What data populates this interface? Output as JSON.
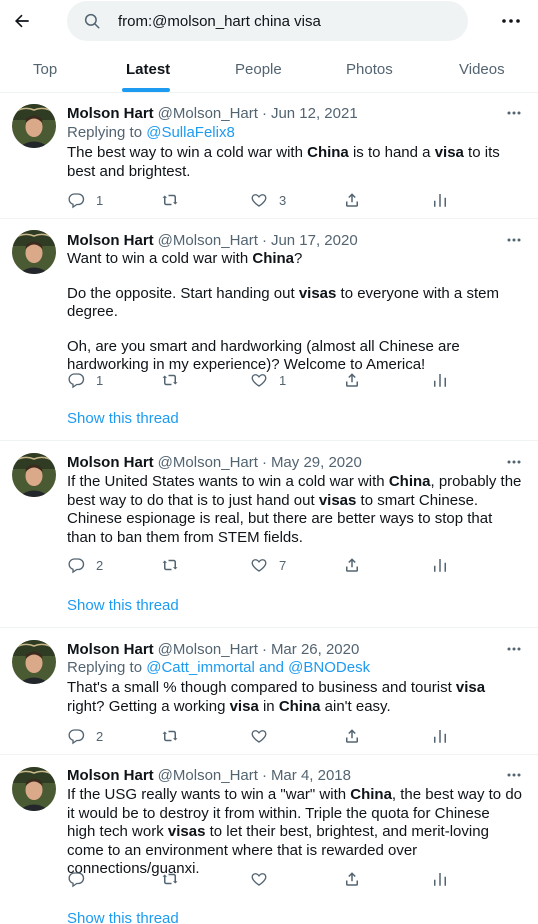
{
  "search": {
    "query": "from:@molson_hart china visa"
  },
  "tabs": [
    "Top",
    "Latest",
    "People",
    "Photos",
    "Videos"
  ],
  "colors": {
    "accent": "#1d9bf0",
    "text": "#0f1419",
    "muted": "#536471"
  },
  "tweets": [
    {
      "name": "Molson Hart",
      "handle": "@Molson_Hart",
      "dot": "·",
      "date": "Jun 12, 2021",
      "replying_label": "Replying to",
      "replying_to": "@SullaFelix8",
      "text_parts": [
        "The best way to win a cold war with ",
        "China",
        " is to hand a ",
        "visa",
        " to its best and brightest."
      ],
      "replies": "1",
      "retweets": "",
      "likes": "3",
      "show_thread": ""
    },
    {
      "name": "Molson Hart",
      "handle": "@Molson_Hart",
      "dot": "·",
      "date": "Jun 17, 2020",
      "p1": [
        "Want to win a cold war with ",
        "China",
        "?"
      ],
      "p2": [
        "Do the opposite. Start handing out ",
        "visas",
        " to everyone with a stem degree."
      ],
      "p3": "Oh, are you smart and hardworking (almost all Chinese are hardworking in my experience)? Welcome to America!",
      "replies": "1",
      "retweets": "",
      "likes": "1",
      "show_thread": "Show this thread"
    },
    {
      "name": "Molson Hart",
      "handle": "@Molson_Hart",
      "dot": "·",
      "date": "May 29, 2020",
      "text_parts": [
        "If the United States wants to win a cold war with ",
        "China",
        ", probably the best way to do that is to just hand out ",
        "visas",
        " to smart Chinese. Chinese espionage is real, but there are better ways to stop that than to ban them from STEM fields."
      ],
      "replies": "2",
      "retweets": "",
      "likes": "7",
      "show_thread": "Show this thread"
    },
    {
      "name": "Molson Hart",
      "handle": "@Molson_Hart",
      "dot": "·",
      "date": "Mar 26, 2020",
      "replying_label": "Replying to",
      "replying_to": "@Catt_immortal and @BNODesk",
      "text_parts": [
        "That's a small % though compared to business and tourist ",
        "visa",
        " right? Getting a working ",
        "visa",
        " in ",
        "China",
        " ain't easy."
      ],
      "replies": "2",
      "retweets": "",
      "likes": "",
      "show_thread": ""
    },
    {
      "name": "Molson Hart",
      "handle": "@Molson_Hart",
      "dot": "·",
      "date": "Mar 4, 2018",
      "text_parts": [
        "If the USG really wants to win a \"war\" with ",
        "China",
        ", the best way to do it would be to destroy it from within. Triple the quota for Chinese high tech work ",
        "visas",
        " to let their best, brightest, and merit-loving come to an environment where that is rewarded over connections/guanxi."
      ],
      "replies": "",
      "retweets": "",
      "likes": "",
      "show_thread": "Show this thread"
    }
  ]
}
